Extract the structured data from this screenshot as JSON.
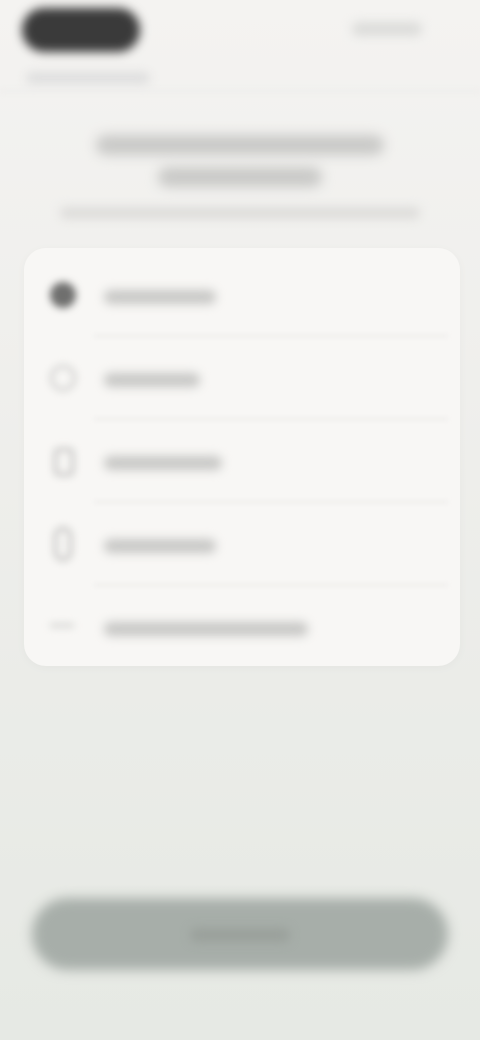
{
  "options": [
    {
      "label": "",
      "icon": "filled-circle-icon"
    },
    {
      "label": "",
      "icon": "ring-circle-icon"
    },
    {
      "label": "",
      "icon": "document-icon"
    },
    {
      "label": "",
      "icon": "paperclip-icon"
    },
    {
      "label": "",
      "icon": "minus-icon"
    }
  ],
  "colors": {
    "background_top": "#f4f3f1",
    "background_bottom": "#e6e9e4",
    "card": "#f8f7f5",
    "button": "#a7aea9",
    "status_pill": "#3a3a3a"
  }
}
